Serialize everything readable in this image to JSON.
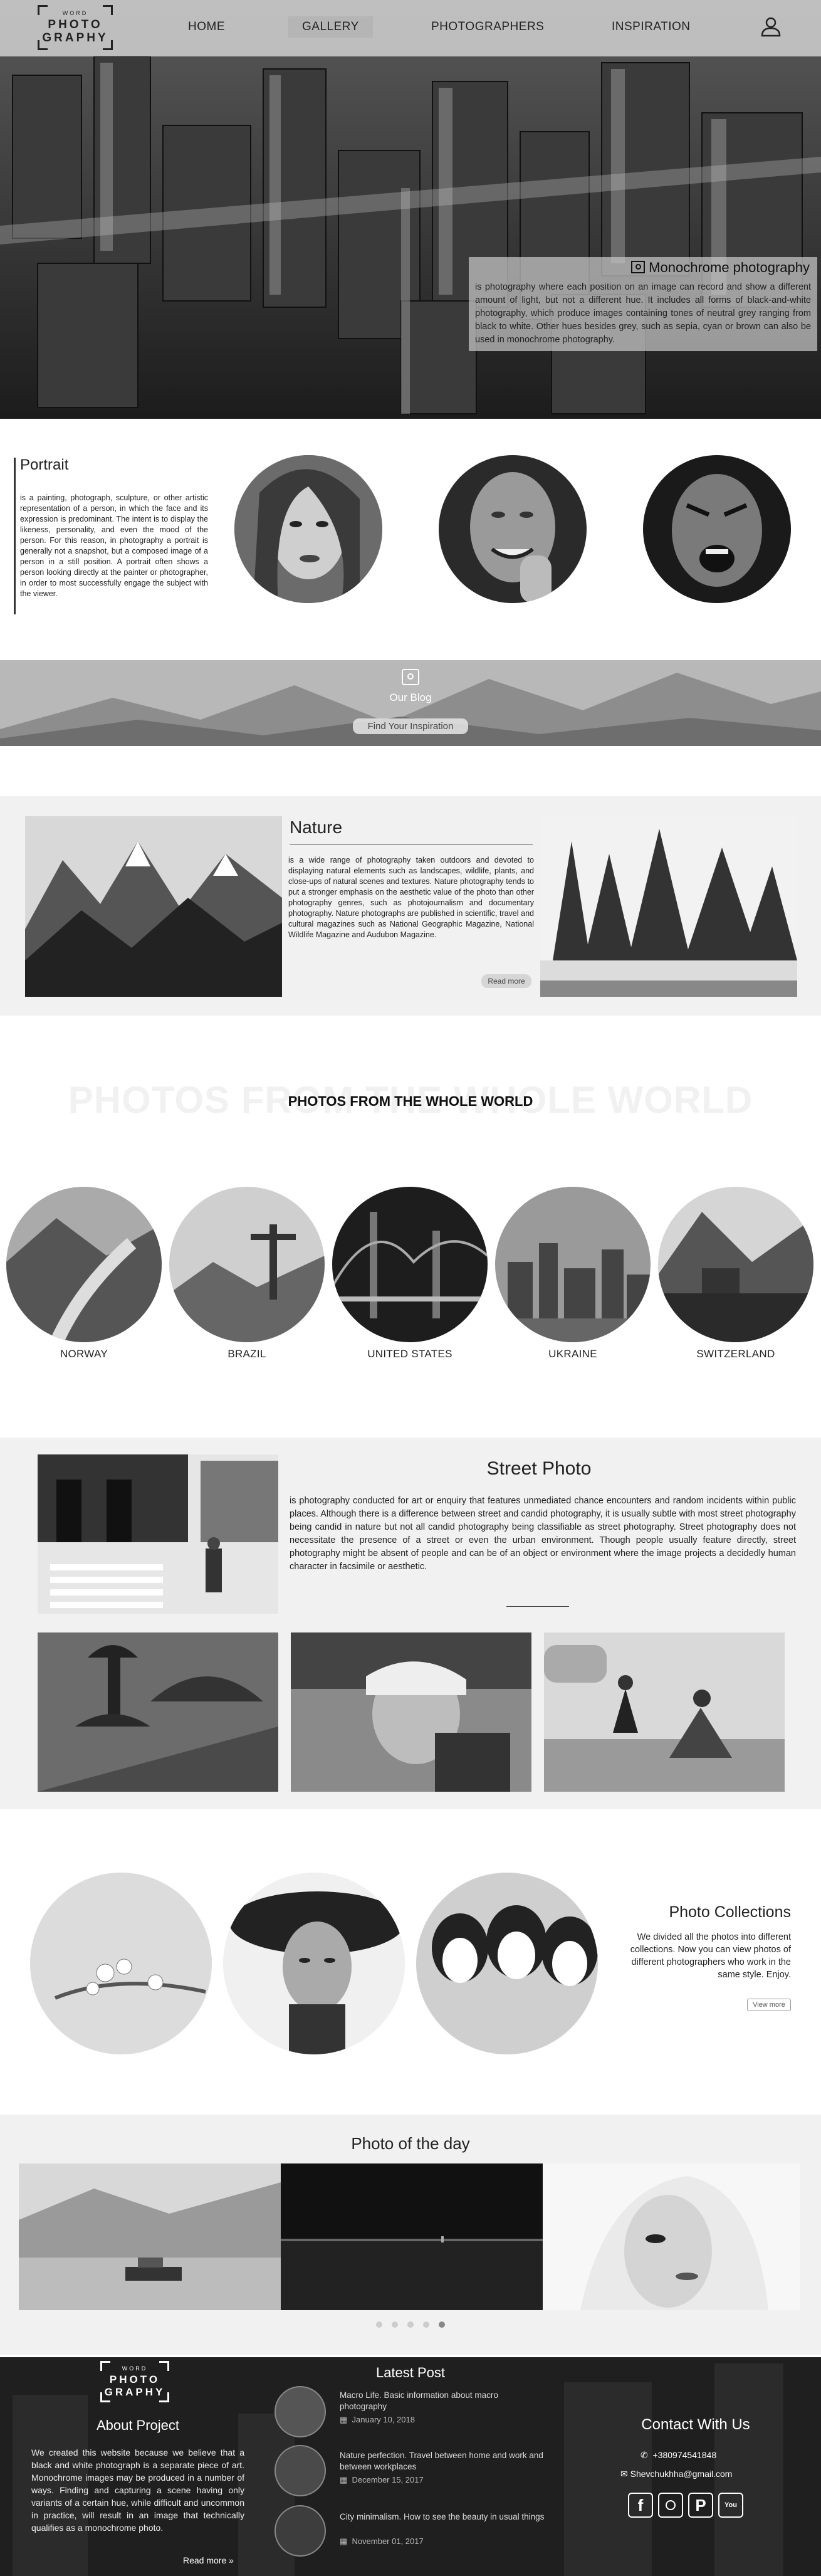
{
  "logo": {
    "small": "WORD",
    "line1": "PHOTO",
    "line2": "GRAPHY"
  },
  "nav": {
    "items": [
      "HOME",
      "GALLERY",
      "PHOTOGRAPHERS",
      "INSPIRATION"
    ],
    "active": "GALLERY",
    "user_icon": "user-icon"
  },
  "hero": {
    "caption_title": "Monochrome photography",
    "caption_text": "is photography where each position on an image can record and show a different amount of light, but not a different hue. It includes all forms of black-and-white photography, which produce images containing tones of neutral grey ranging from black to white. Other hues besides grey, such as sepia, cyan or brown can also be used in monochrome photography."
  },
  "portrait": {
    "title": "Portrait",
    "text": "is a painting, photograph, sculpture, or other artistic representation of a person, in which the face and its expression is predominant. The intent is to display the likeness, personality, and even the mood of the person. For this reason, in photography a portrait is generally not a snapshot, but a composed image of a person in a still position. A portrait often shows a person looking directly at the painter or photographer, in order to most successfully engage the subject with the viewer."
  },
  "blog_banner": {
    "label": "Our Blog",
    "button": "Find Your Inspiration"
  },
  "nature": {
    "title": "Nature",
    "text": "is a wide range of photography taken outdoors and devoted to displaying natural elements such as landscapes, wildlife, plants, and close-ups of natural scenes and textures. Nature photography tends to put a stronger emphasis on the aesthetic value of the photo than other photography genres, such as photojournalism and documentary photography. Nature photographs are published in scientific, travel and cultural magazines such as National Geographic Magazine, National Wildlife Magazine and Audubon Magazine.",
    "button": "Read more"
  },
  "world": {
    "watermark": "PHOTOS FROM THE WHOLE WORLD",
    "title": "PHOTOS FROM THE WHOLE WORLD",
    "countries": [
      "NORWAY",
      "BRAZIL",
      "UNITED STATES",
      "UKRAINE",
      "SWITZERLAND"
    ]
  },
  "street": {
    "title": "Street Photo",
    "text": "is photography conducted for art or enquiry that features unmediated chance encounters and random incidents within public places. Although there is a difference between street and candid photography, it is usually subtle with most street photography being candid in nature but not all candid photography being classifiable as street photography. Street photography does not necessitate the presence of a street or even the urban environment. Though people usually feature directly, street photography might be absent of people and can be of an object or environment where the image projects a decidedly human character in facsimile or aesthetic."
  },
  "collections": {
    "title": "Photo Collections",
    "text": "We divided all the photos into different collections. Now you can view photos of different photographers who work in the same style. Enjoy.",
    "button": "View more"
  },
  "potd": {
    "title": "Photo of the day",
    "dots": 5,
    "active_dot": 5
  },
  "footer": {
    "about_title": "About Project",
    "about_text": "We created this website because we believe that a black and white photograph is a separate piece of art. Monochrome images may be produced in a number of ways. Finding and capturing a scene having only variants of a certain hue, while difficult and uncommon in practice, will result in an image that technically qualifies as a monochrome photo.",
    "read_more": "Read more »",
    "latest_title": "Latest Post",
    "posts": [
      {
        "title": "Macro Life. Basic information about macro photography",
        "date": "January 10, 2018"
      },
      {
        "title": "Nature perfection. Travel between home and work and between workplaces",
        "date": "December 15, 2017"
      },
      {
        "title": "City minimalism. How to see the beauty in usual things",
        "date": "November 01, 2017"
      }
    ],
    "contact_title": "Contact With Us",
    "phone": "+380974541848",
    "email": "Shevchukhha@gmail.com",
    "social": [
      "facebook-icon",
      "instagram-icon",
      "pinterest-icon",
      "youtube-icon"
    ]
  }
}
